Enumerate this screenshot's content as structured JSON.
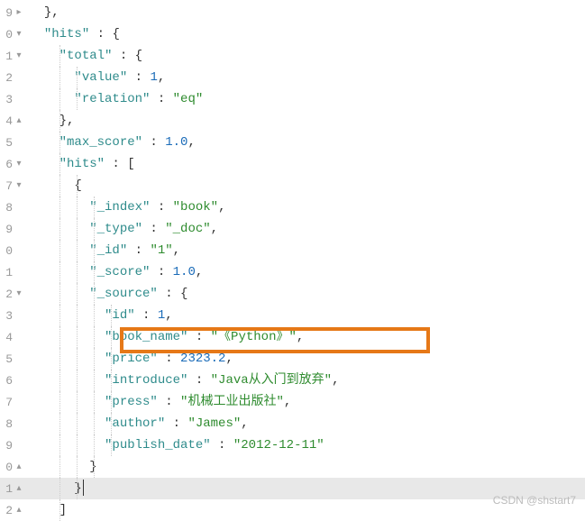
{
  "gutter": [
    {
      "num": "9",
      "fold": "▸"
    },
    {
      "num": "0",
      "fold": "▾"
    },
    {
      "num": "1",
      "fold": "▾"
    },
    {
      "num": "2",
      "fold": ""
    },
    {
      "num": "3",
      "fold": ""
    },
    {
      "num": "4",
      "fold": "▴"
    },
    {
      "num": "5",
      "fold": ""
    },
    {
      "num": "6",
      "fold": "▾"
    },
    {
      "num": "7",
      "fold": "▾"
    },
    {
      "num": "8",
      "fold": ""
    },
    {
      "num": "9",
      "fold": ""
    },
    {
      "num": "0",
      "fold": ""
    },
    {
      "num": "1",
      "fold": ""
    },
    {
      "num": "2",
      "fold": "▾"
    },
    {
      "num": "3",
      "fold": ""
    },
    {
      "num": "4",
      "fold": ""
    },
    {
      "num": "5",
      "fold": ""
    },
    {
      "num": "6",
      "fold": ""
    },
    {
      "num": "7",
      "fold": ""
    },
    {
      "num": "8",
      "fold": ""
    },
    {
      "num": "9",
      "fold": ""
    },
    {
      "num": "0",
      "fold": "▴"
    },
    {
      "num": "1",
      "fold": "▴"
    },
    {
      "num": "2",
      "fold": "▴"
    }
  ],
  "tokens": {
    "l0": {
      "t1": "},"
    },
    "l1": {
      "t1": "\"hits\"",
      "t2": " : {"
    },
    "l2": {
      "t1": "\"total\"",
      "t2": " : {"
    },
    "l3": {
      "t1": "\"value\"",
      "t2": " : ",
      "t3": "1",
      "t4": ","
    },
    "l4": {
      "t1": "\"relation\"",
      "t2": " : ",
      "t3": "\"eq\""
    },
    "l5": {
      "t1": "},"
    },
    "l6": {
      "t1": "\"max_score\"",
      "t2": " : ",
      "t3": "1.0",
      "t4": ","
    },
    "l7": {
      "t1": "\"hits\"",
      "t2": " : ["
    },
    "l8": {
      "t1": "{"
    },
    "l9": {
      "t1": "\"_index\"",
      "t2": " : ",
      "t3": "\"book\"",
      "t4": ","
    },
    "l10": {
      "t1": "\"_type\"",
      "t2": " : ",
      "t3": "\"_doc\"",
      "t4": ","
    },
    "l11": {
      "t1": "\"_id\"",
      "t2": " : ",
      "t3": "\"1\"",
      "t4": ","
    },
    "l12": {
      "t1": "\"_score\"",
      "t2": " : ",
      "t3": "1.0",
      "t4": ","
    },
    "l13": {
      "t1": "\"_source\"",
      "t2": " : {"
    },
    "l14": {
      "t1": "\"id\"",
      "t2": " : ",
      "t3": "1",
      "t4": ","
    },
    "l15": {
      "t1": "\"book_name\"",
      "t2": " : ",
      "t3": "\"《Python》\"",
      "t4": ","
    },
    "l16": {
      "t1": "\"price\"",
      "t2": " : ",
      "t3": "2323.2",
      "t4": ","
    },
    "l17": {
      "t1": "\"introduce\"",
      "t2": " : ",
      "t3": "\"Java从入门到放弃\"",
      "t4": ","
    },
    "l18": {
      "t1": "\"press\"",
      "t2": " : ",
      "t3": "\"机械工业出版社\"",
      "t4": ","
    },
    "l19": {
      "t1": "\"author\"",
      "t2": " : ",
      "t3": "\"James\"",
      "t4": ","
    },
    "l20": {
      "t1": "\"publish_date\"",
      "t2": " : ",
      "t3": "\"2012-12-11\""
    },
    "l21": {
      "t1": "}"
    },
    "l22": {
      "t1": "}"
    },
    "l23": {
      "t1": "]"
    }
  },
  "watermark": "CSDN @shstart7"
}
